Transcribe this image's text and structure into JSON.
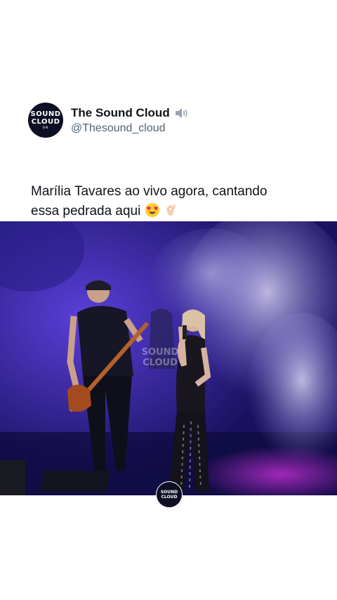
{
  "account": {
    "display_name": "The Sound Cloud",
    "handle": "@Thesound_cloud",
    "avatar_text_line1": "SOUND",
    "avatar_text_line2": "CLOUD",
    "avatar_subtext": "ON",
    "verified_icon": "speaker-icon"
  },
  "tweet": {
    "text_line1": "Marília Tavares ao vivo agora, cantando",
    "text_line2": "essa pedrada aqui",
    "emojis": [
      "smiling-face-with-heart-eyes",
      "ok-hand"
    ]
  },
  "video": {
    "watermark_line1": "SOUND",
    "watermark_line2": "CLOUD",
    "overlay_line1": "SOUND",
    "overlay_line2": "CLOUD"
  },
  "colors": {
    "text": "#0f1419",
    "secondary": "#536471",
    "avatar_bg": "#0d0f24"
  }
}
